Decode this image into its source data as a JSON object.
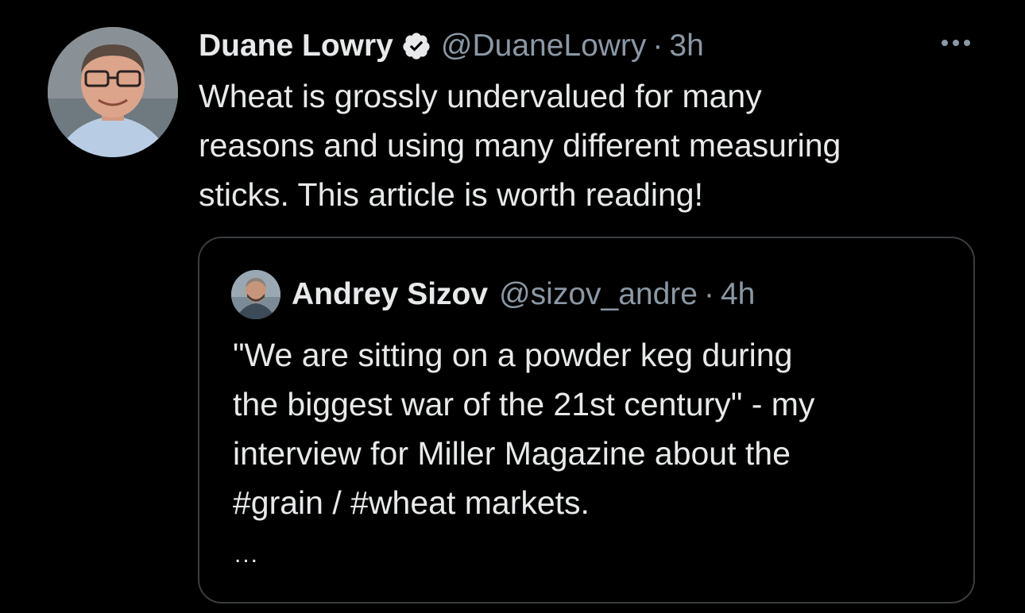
{
  "tweet": {
    "author": {
      "display_name": "Duane Lowry",
      "handle": "@DuaneLowry",
      "verified": true,
      "avatar_icon": "profile-photo"
    },
    "separator": "·",
    "time": "3h",
    "text": "Wheat is grossly undervalued for many\nreasons and using many different measuring\nsticks. This article is worth reading!",
    "more_icon": "more-options-icon"
  },
  "quote": {
    "author": {
      "display_name": "Andrey Sizov",
      "handle": "@sizov_andre",
      "avatar_icon": "profile-photo"
    },
    "separator": "·",
    "time": "4h",
    "text": "\"We are sitting on a powder keg during\nthe biggest war of the 21st century\" - my\ninterview for Miller Magazine about the\n#grain / #wheat markets.",
    "truncation": "..."
  },
  "colors": {
    "background": "#000000",
    "text_primary": "#e7e9ea",
    "text_secondary": "#8b98a5",
    "border": "#3a3d40"
  }
}
